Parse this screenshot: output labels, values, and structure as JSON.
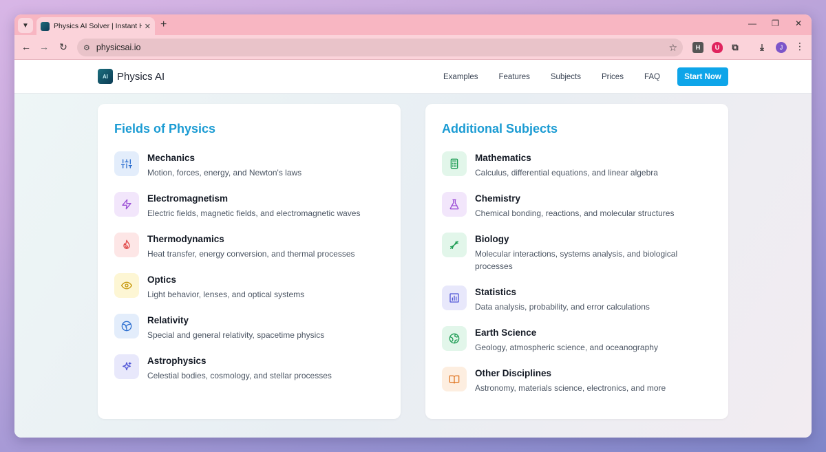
{
  "browser": {
    "tab_title": "Physics AI Solver | Instant Homew",
    "url": "physicsai.io",
    "profile_initial": "J",
    "ext_h": "H",
    "icons": {
      "tab_menu": "chevron-down-icon",
      "close": "close-icon",
      "new_tab": "plus-icon",
      "minimize": "minimize-icon",
      "restore": "restore-icon",
      "window_close": "close-icon",
      "back": "arrow-left-icon",
      "forward": "arrow-right-icon",
      "reload": "reload-icon",
      "site_info": "tune-icon",
      "bookmark": "star-icon",
      "extensions": "puzzle-icon",
      "download": "download-icon",
      "menu": "kebab-icon"
    }
  },
  "header": {
    "brand": "Physics AI",
    "nav": [
      "Examples",
      "Features",
      "Subjects",
      "Prices",
      "FAQ"
    ],
    "cta": "Start Now"
  },
  "fields": {
    "title": "Fields of Physics",
    "items": [
      {
        "name": "Mechanics",
        "desc": "Motion, forces, energy, and Newton's laws",
        "icon": "sliders-icon",
        "bg": "#e3edfb",
        "fg": "#2d6fd0"
      },
      {
        "name": "Electromagnetism",
        "desc": "Electric fields, magnetic fields, and electromagnetic waves",
        "icon": "lightning-icon",
        "bg": "#f2e6fb",
        "fg": "#9b4fd6"
      },
      {
        "name": "Thermodynamics",
        "desc": "Heat transfer, energy conversion, and thermal processes",
        "icon": "flame-icon",
        "bg": "#fde6e6",
        "fg": "#e04848"
      },
      {
        "name": "Optics",
        "desc": "Light behavior, lenses, and optical systems",
        "icon": "eye-icon",
        "bg": "#fdf6d4",
        "fg": "#c89a10"
      },
      {
        "name": "Relativity",
        "desc": "Special and general relativity, spacetime physics",
        "icon": "orbit-icon",
        "bg": "#e3edfb",
        "fg": "#2d6fd0"
      },
      {
        "name": "Astrophysics",
        "desc": "Celestial bodies, cosmology, and stellar processes",
        "icon": "sparkles-icon",
        "bg": "#e8e8fb",
        "fg": "#4f55d6"
      }
    ]
  },
  "subjects": {
    "title": "Additional Subjects",
    "items": [
      {
        "name": "Mathematics",
        "desc": "Calculus, differential equations, and linear algebra",
        "icon": "calculator-icon",
        "bg": "#e2f6ea",
        "fg": "#1f9d55"
      },
      {
        "name": "Chemistry",
        "desc": "Chemical bonding, reactions, and molecular structures",
        "icon": "flask-icon",
        "bg": "#f2e6fb",
        "fg": "#9b4fd6"
      },
      {
        "name": "Biology",
        "desc": "Molecular interactions, systems analysis, and biological processes",
        "icon": "dna-icon",
        "bg": "#e2f6ea",
        "fg": "#1f9d55"
      },
      {
        "name": "Statistics",
        "desc": "Data analysis, probability, and error calculations",
        "icon": "bar-chart-icon",
        "bg": "#e8e8fb",
        "fg": "#4f55d6"
      },
      {
        "name": "Earth Science",
        "desc": "Geology, atmospheric science, and oceanography",
        "icon": "globe-icon",
        "bg": "#e2f6ea",
        "fg": "#1f9d55"
      },
      {
        "name": "Other Disciplines",
        "desc": "Astronomy, materials science, electronics, and more",
        "icon": "book-icon",
        "bg": "#fdeee0",
        "fg": "#e07b2a"
      }
    ]
  },
  "colors": {
    "accent": "#0ea5e9",
    "section_title": "#1a9bd3"
  }
}
